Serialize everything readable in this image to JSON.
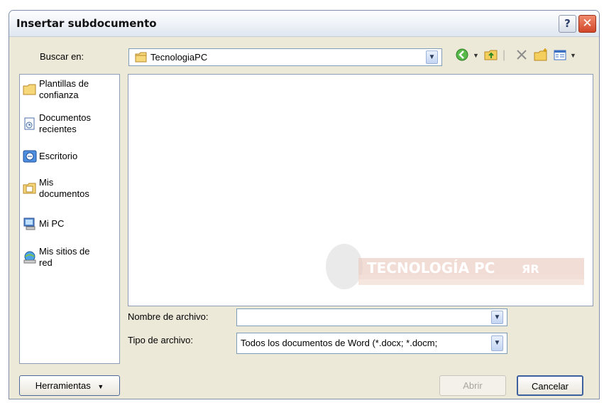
{
  "window": {
    "title": "Insertar subdocumento"
  },
  "titlebar": {
    "help_symbol": "?",
    "close_symbol": "✕"
  },
  "lookin": {
    "label": "Buscar en:",
    "value": "TecnologiaPC"
  },
  "places": [
    {
      "icon": "folder-icon",
      "line1": "Plantillas de",
      "line2": "confianza"
    },
    {
      "icon": "recent-documents-icon",
      "line1": "Documentos",
      "line2": "recientes"
    },
    {
      "icon": "desktop-icon",
      "line1": "Escritorio",
      "line2": ""
    },
    {
      "icon": "my-documents-icon",
      "line1": "Mis",
      "line2": "documentos"
    },
    {
      "icon": "my-computer-icon",
      "line1": "Mi PC",
      "line2": ""
    },
    {
      "icon": "network-places-icon",
      "line1": "Mis sitios de",
      "line2": "red"
    }
  ],
  "watermark": {
    "text": "TECNOLOGÍA PC",
    "logo_text": "ЯR"
  },
  "filename": {
    "label": "Nombre de archivo:",
    "value": ""
  },
  "filetype": {
    "label": "Tipo de archivo:",
    "value": "Todos los documentos de Word (*.docx; *.docm;"
  },
  "buttons": {
    "tools": "Herramientas",
    "open": "Abrir",
    "cancel": "Cancelar"
  }
}
